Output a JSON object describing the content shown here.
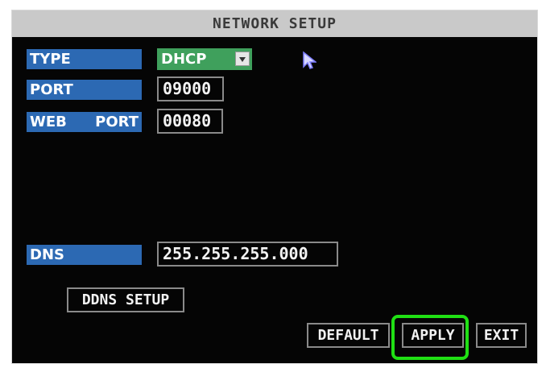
{
  "window": {
    "title": "NETWORK SETUP"
  },
  "fields": {
    "type": {
      "label": "TYPE",
      "selected": "DHCP"
    },
    "port": {
      "label": "PORT",
      "value": "09000"
    },
    "web_port": {
      "label_left": "WEB",
      "label_right": "PORT",
      "value": "00080"
    },
    "dns": {
      "label": "DNS",
      "value": "255.255.255.000"
    }
  },
  "buttons": {
    "ddns_setup": "DDNS SETUP",
    "default": "DEFAULT",
    "apply": "APPLY",
    "exit": "EXIT"
  },
  "icons": {
    "dropdown_arrow": "chevron-down-icon",
    "cursor": "mouse-pointer-icon"
  },
  "colors": {
    "title_bar": "#c9c9c9",
    "label_blue": "#2c69b3",
    "dropdown_green": "#3fa05c",
    "highlight_green": "#20e014"
  }
}
